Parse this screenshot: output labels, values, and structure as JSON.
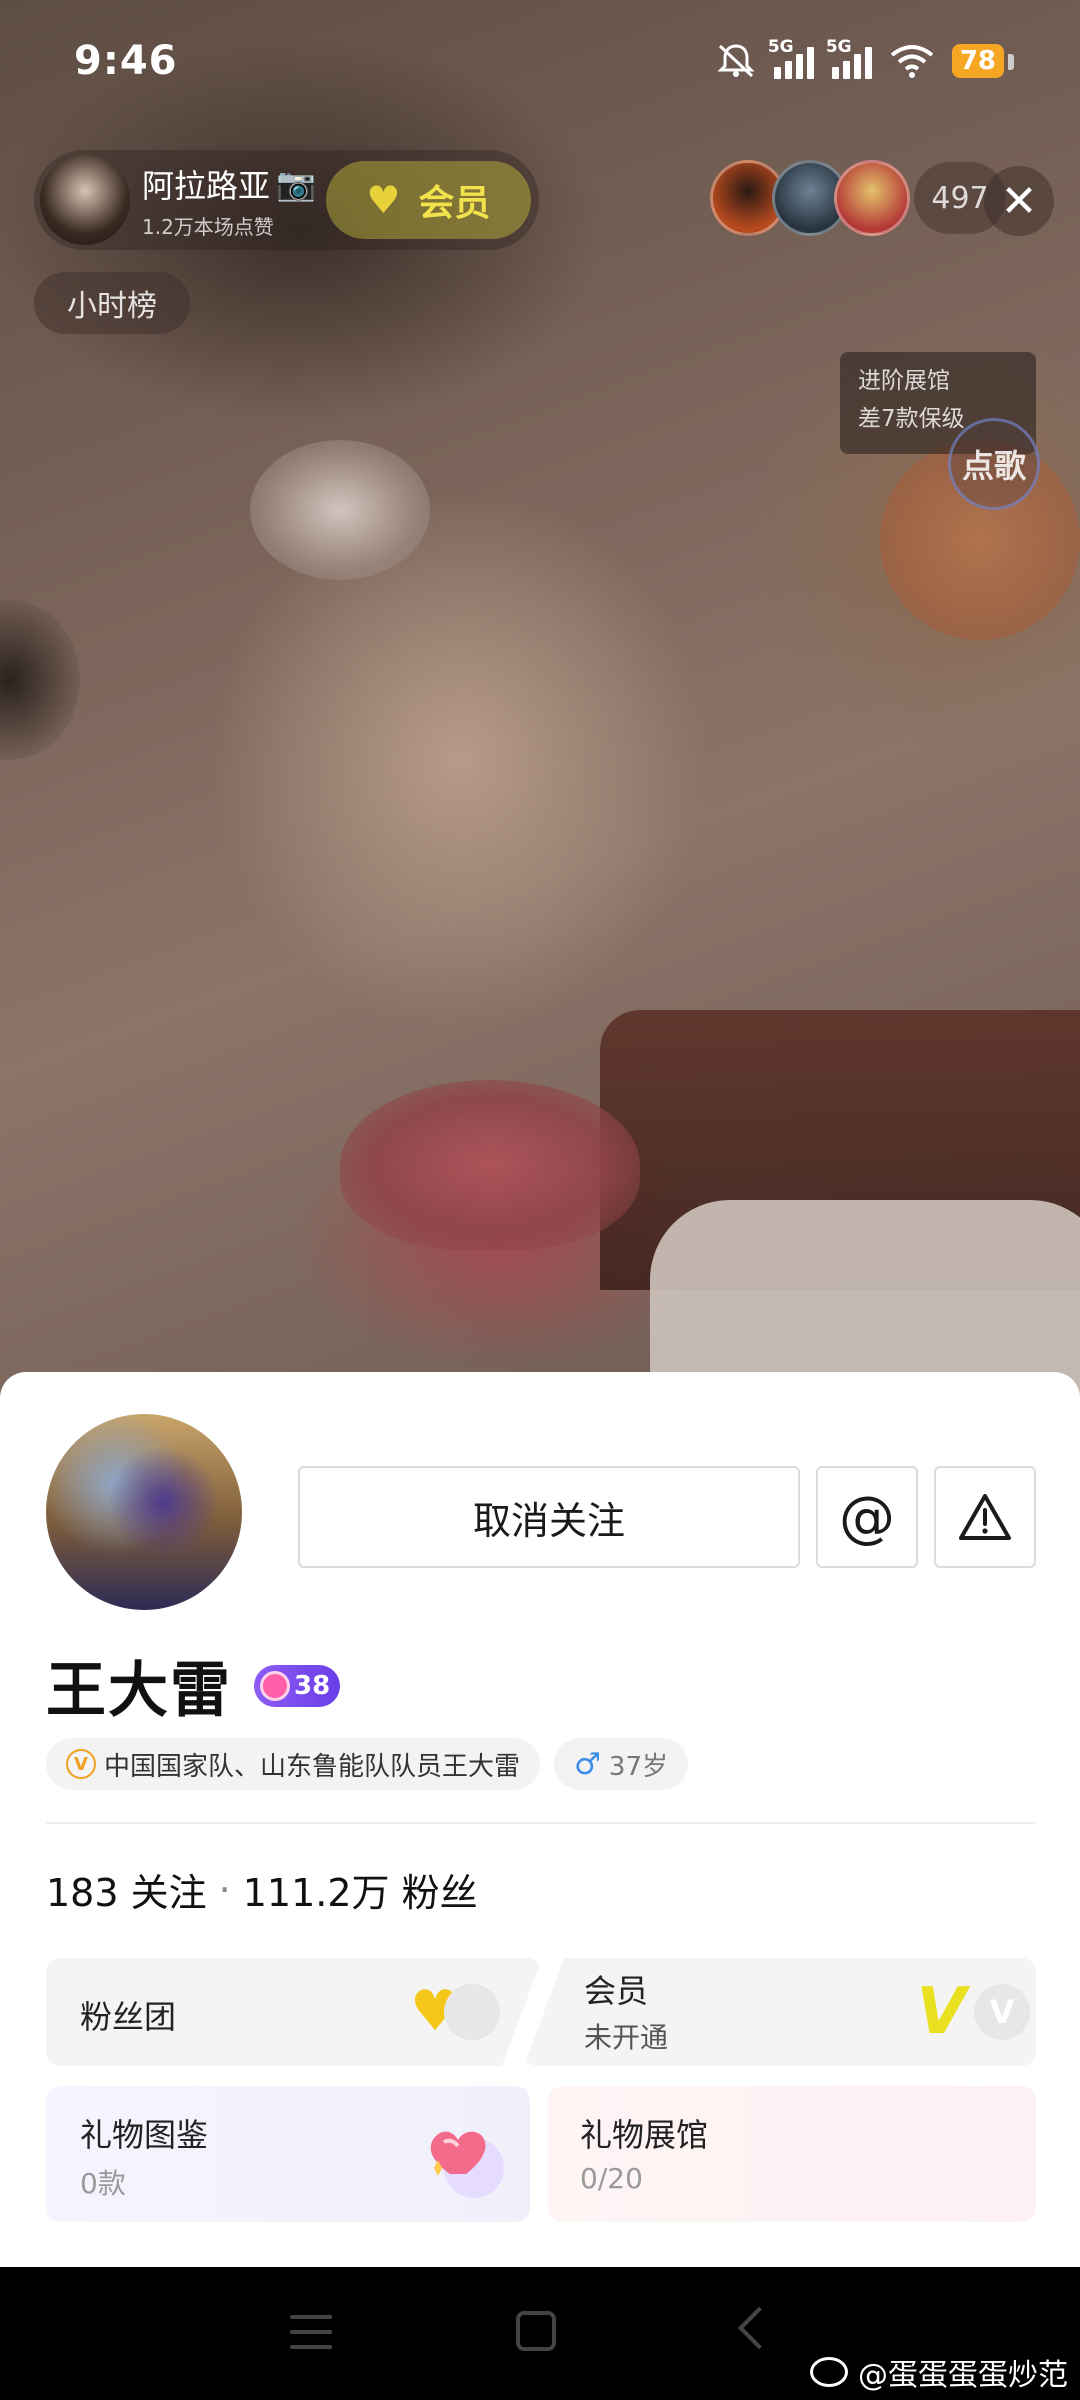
{
  "status_bar": {
    "time": "9:46",
    "network_1": "5G",
    "network_2": "5G",
    "battery": "78"
  },
  "stream": {
    "host_name": "阿拉路亚",
    "host_likes": "1.2万本场点赞",
    "member_label": "会员",
    "viewer_count": "497",
    "hour_rank": "小时榜",
    "promo_line1": "进阶展馆",
    "promo_line2": "差7款保级",
    "song_button": "点歌"
  },
  "profile": {
    "unfollow_button": "取消关注",
    "at_button": "@",
    "name": "王大雷",
    "level": "38",
    "verified_tag": "中国国家队、山东鲁能队队员王大雷",
    "verified_mark": "V",
    "gender_symbol": "♂",
    "age": "37岁",
    "following_count": "183",
    "following_label": "关注",
    "separator": "·",
    "fans_count": "111.2万",
    "fans_label": "粉丝",
    "fan_club": "粉丝团",
    "member_title": "会员",
    "member_status": "未开通",
    "gift_guide_title": "礼物图鉴",
    "gift_guide_count": "0款",
    "gift_hall_title": "礼物展馆",
    "gift_hall_count": "0/20"
  },
  "watermark": "@蛋蛋蛋蛋炒范",
  "colors": {
    "accent_gold": "#f5c718",
    "level_purple": "#7a4cf0",
    "verified_orange": "#f0a020",
    "male_blue": "#3a8de6"
  }
}
